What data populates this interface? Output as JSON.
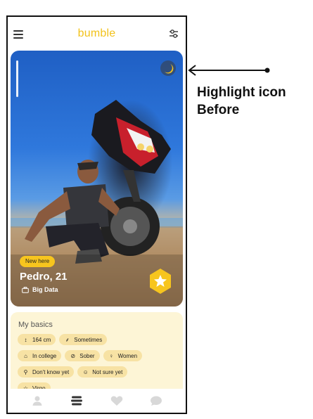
{
  "app": {
    "logo": "bumble"
  },
  "header": {
    "menu_icon": "hamburger-menu-icon",
    "filter_icon": "filter-sliders-icon"
  },
  "profile": {
    "badge": "New here",
    "name": "Pedro, 21",
    "job": "Big Data",
    "job_icon": "briefcase-icon",
    "highlight_icon": "moon-highlight-icon",
    "superlike_icon": "star-hexagon-icon"
  },
  "basics": {
    "title": "My basics",
    "chips": [
      {
        "icon": "height-icon",
        "label": "164 cm"
      },
      {
        "icon": "drink-icon",
        "label": "Sometimes"
      },
      {
        "icon": "education-icon",
        "label": "In college"
      },
      {
        "icon": "no-smoking-icon",
        "label": "Sober"
      },
      {
        "icon": "gender-icon",
        "label": "Women"
      },
      {
        "icon": "search-icon",
        "label": "Don't know yet"
      },
      {
        "icon": "smile-icon",
        "label": "Not sure yet"
      },
      {
        "icon": "star-icon",
        "label": "Virgo"
      }
    ]
  },
  "navbar": {
    "items": [
      "profile-icon",
      "discover-icon",
      "likes-heart-icon",
      "chat-icon"
    ],
    "active": "discover-icon"
  },
  "annotation": {
    "line1": "Highlight icon",
    "line2": "Before"
  },
  "colors": {
    "brand": "#f2c21b",
    "chip_bg": "#f7e2a4",
    "basics_bg": "#fdf5d6",
    "badge": "#f7c51e"
  }
}
